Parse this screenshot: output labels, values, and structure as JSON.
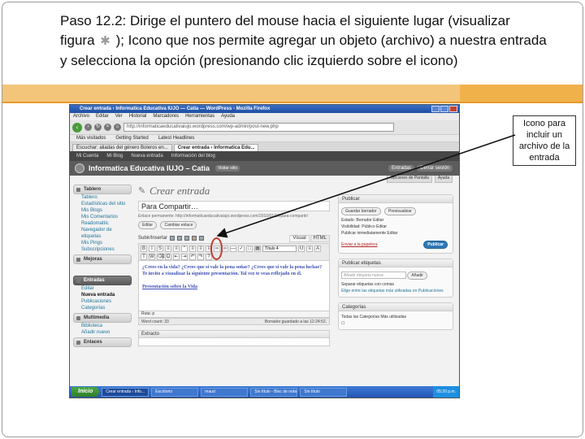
{
  "instruction": {
    "part1": "Paso 12.2: Dirige el puntero del mouse hacia el siguiente lugar (visualizar figura",
    "icon_name": "asterisk-icon",
    "icon_glyph": "✱",
    "part2": "); Icono que nos permite agregar un objeto (archivo) a nuestra entrada y selecciona la opción (presionando clic izquierdo sobre el icono)"
  },
  "callout": {
    "text": "Icono para incluir un archivo de la entrada"
  },
  "browser": {
    "window_title": "Crear entrada ‹ Informatica Educativa IUJO — Catia — WordPress - Mozilla Firefox",
    "menu": [
      "Archivo",
      "Editar",
      "Ver",
      "Historial",
      "Marcadores",
      "Herramientas",
      "Ayuda"
    ],
    "url": "http://informaticaeducativaiujo.wordpress.com/wp-admin/post-new.php",
    "bookmarks": [
      "Más visitados",
      "Getting Started",
      "Latest Headlines"
    ],
    "tabs": [
      "Escuchar: aliadas del género Boleros en...",
      "Crear entrada ‹ Informatica Edu..."
    ]
  },
  "wp": {
    "admin_bar": [
      "Mi Cuenta",
      "Mi Blog",
      "Nueva entrada",
      "Información del blog"
    ],
    "site_title": "Informatica Educativa IUJO – Catia",
    "site_button": "Visitar sitio",
    "head_buttons": [
      "Entradas",
      "Cerrar sesión"
    ],
    "screen_options": [
      "Opciones de Pantalla",
      "Ayuda"
    ],
    "sidebar": [
      {
        "label": "Tablero",
        "items": [
          "Tablero",
          "Estadísticas del sitio",
          "Mis Blogs",
          "Mis Comentarios",
          "Readomattic",
          "Navegador de etiquetas",
          "Mis Pings",
          "Subscripciones"
        ],
        "dark": false
      },
      {
        "label": "Mejoras",
        "items": [],
        "dark": false
      },
      {
        "label": "Entradas",
        "items": [
          "Editar",
          "Nueva entrada",
          "Publicaciones",
          "Categorías"
        ],
        "dark": true
      },
      {
        "label": "Multimedia",
        "items": [
          "Biblioteca",
          "Añadir nuevo"
        ],
        "dark": false
      },
      {
        "label": "Enlaces",
        "items": [],
        "dark": false
      }
    ],
    "page_title": "Crear entrada",
    "post_title": "Para Compartir…",
    "permalink": "Enlace permanente: http://informaticaeducativaiujo.wordpress.com/2010/01/10/para-compartir/",
    "permalink_buttons": [
      "Editar",
      "Cambiar enlace"
    ],
    "upload_label": "Subir/Insertar",
    "editor_tabs": [
      "Visual",
      "HTML"
    ],
    "format_select": "Título 4",
    "content_line1": "¿Crees en la vida? ¿Crees que si vale la pena soñar? ¿Crees que si vale la pena luchar? Te invito a visualizar la siguiente presentación. Tal vez te veas reflejado en él.",
    "content_line2": "Presentación sobre la Vida",
    "path": "Ruta: p",
    "word_count": "Word count: 33",
    "draft_saved": "Borrador guardado a las 12:24:52.",
    "extract_label": "Extracto",
    "publish": {
      "header": "Publicar",
      "save_draft": "Guardar borrador",
      "preview": "Previsualizar",
      "status": "Estado: Borrador  Editar",
      "visibility": "Visibilidad: Público  Editar",
      "schedule": "Publicar inmediatamente  Editar",
      "trash": "Enviar a la papelera",
      "publish_btn": "Publicar"
    },
    "tags": {
      "header": "Publicar etiquetas",
      "placeholder": "Añadir etiqueta nueva",
      "add": "Añadir",
      "hint": "Separar etiquetas con comas",
      "choose": "Elige entre las etiquetas más utilizadas en Publicaciones"
    },
    "categories": {
      "header": "Categorías",
      "tabs": "Todas las Categorías  Más utilizadas"
    }
  },
  "taskbar": {
    "start": "Inicio",
    "tasks": [
      "Crear entrada ‹ Info...",
      "Escritorio",
      "maud",
      "Sin título - Bloc de notas",
      "Sin título"
    ],
    "clock": "05:20 p.m."
  }
}
